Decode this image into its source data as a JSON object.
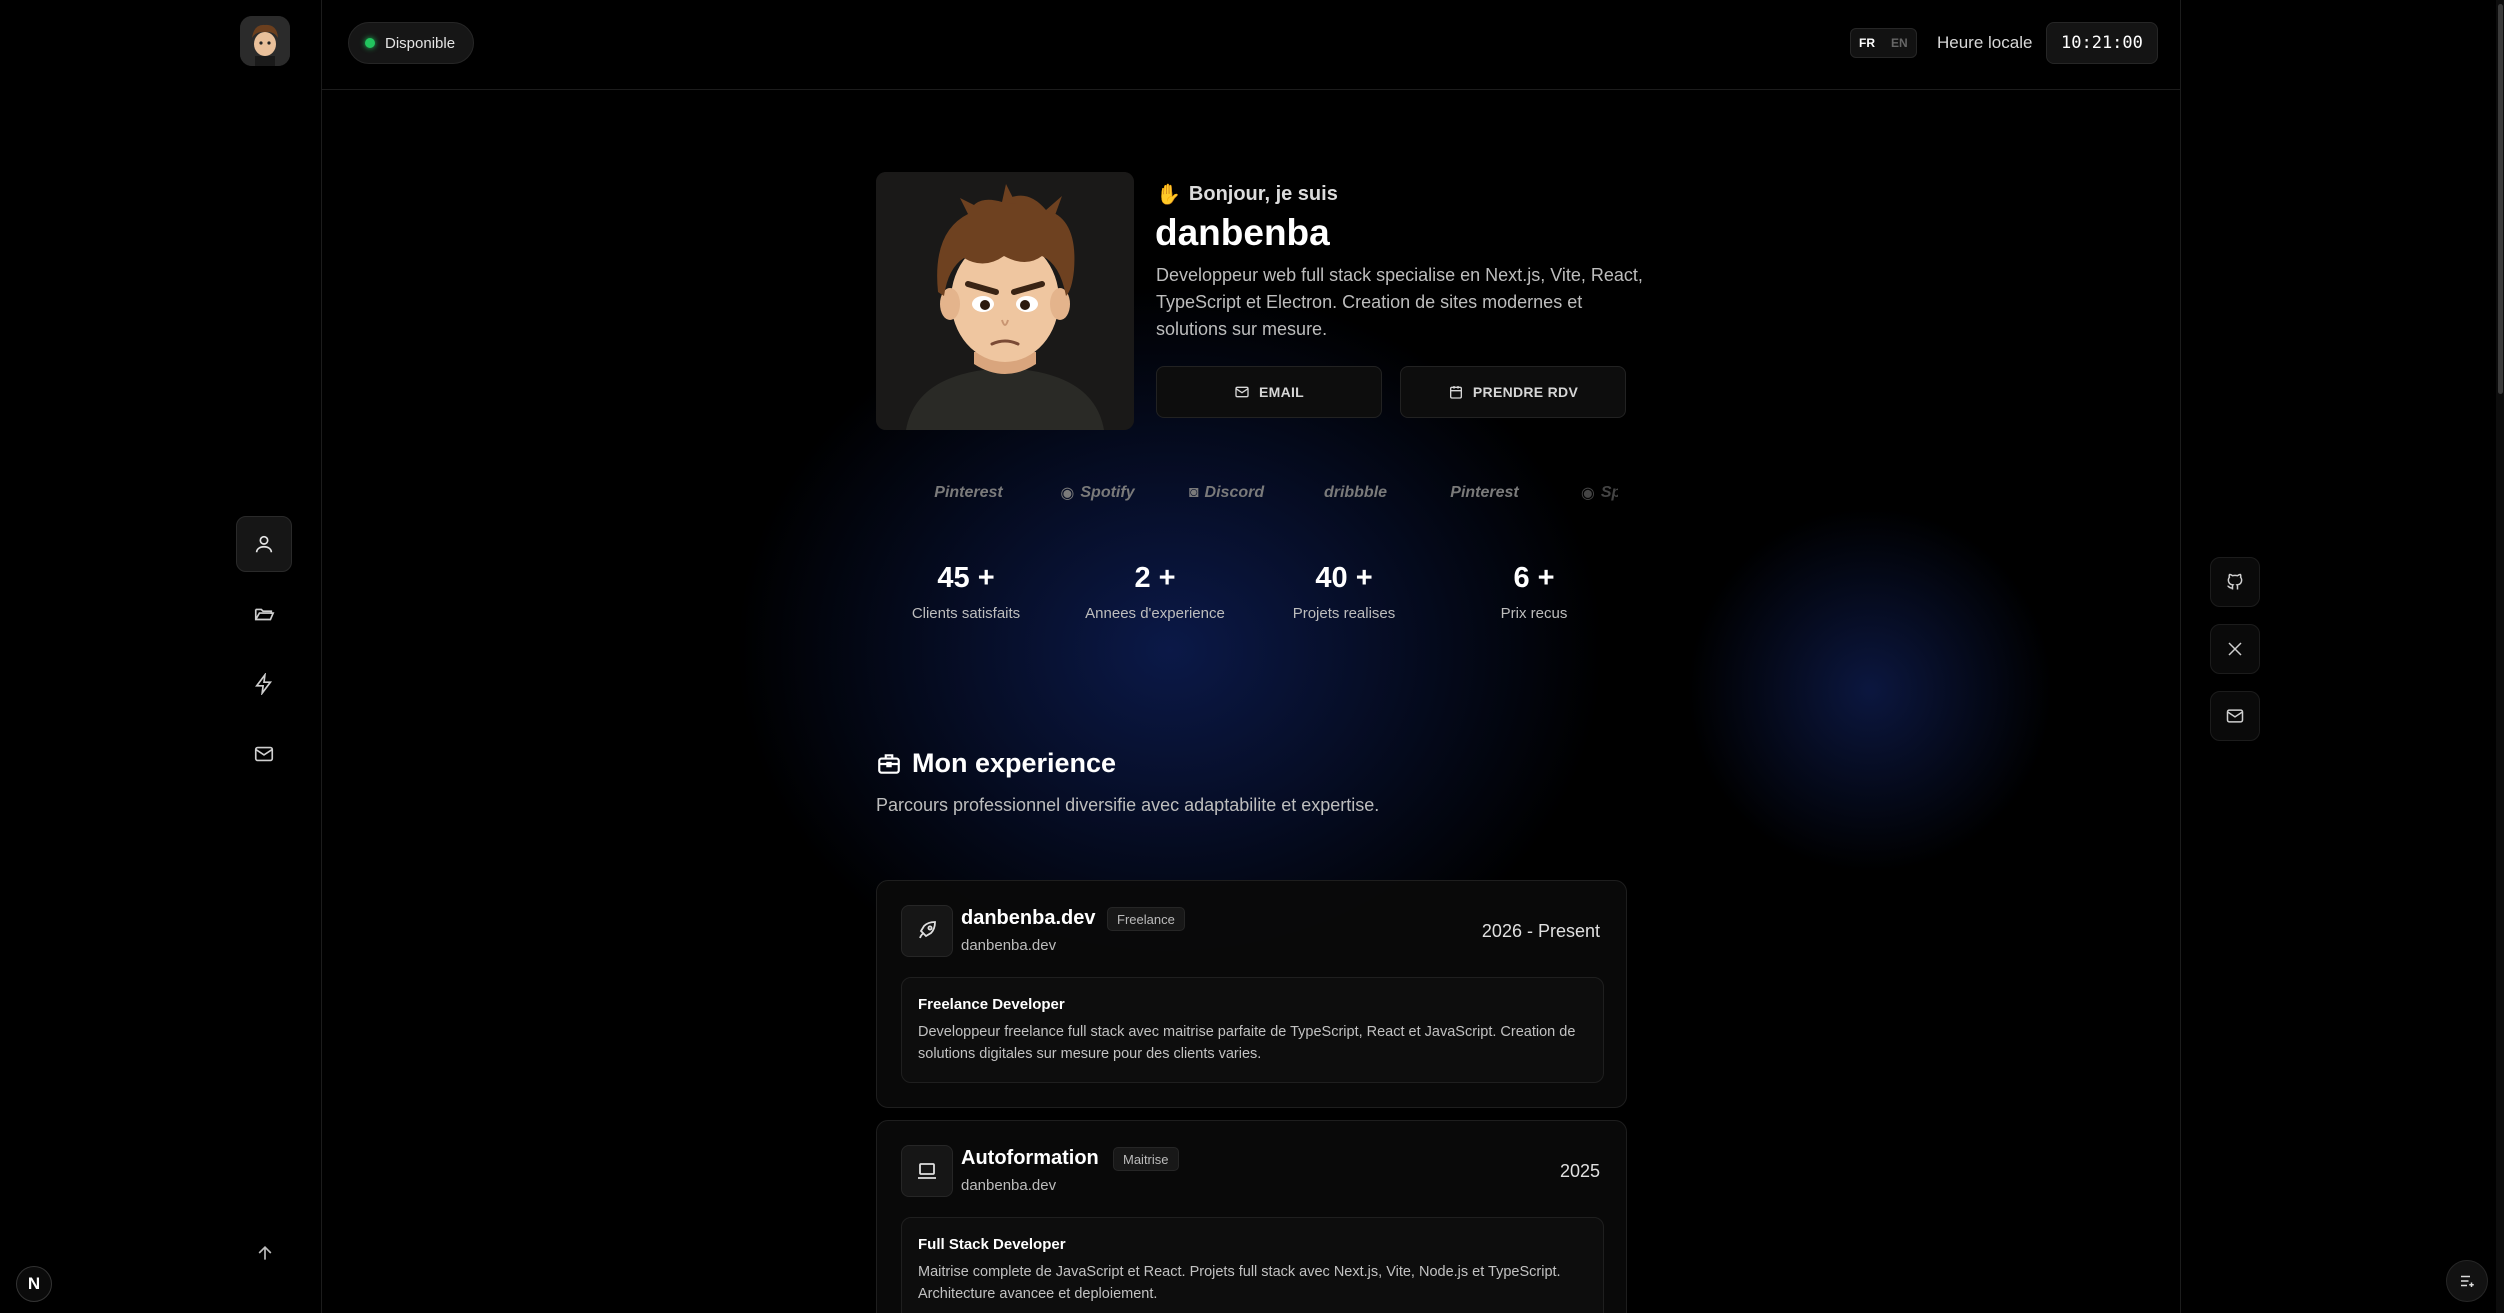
{
  "topbar": {
    "status": "Disponible",
    "lang_fr": "FR",
    "lang_en": "EN",
    "local_time_label": "Heure locale",
    "clock": "10:21:00"
  },
  "sidebar": {
    "items": [
      {
        "name": "profile",
        "icon": "user-icon",
        "active": true
      },
      {
        "name": "projects",
        "icon": "folder-open-icon",
        "active": false
      },
      {
        "name": "skills",
        "icon": "lightning-icon",
        "active": false
      },
      {
        "name": "contact",
        "icon": "mail-icon",
        "active": false
      }
    ],
    "scroll_top_icon": "arrow-up-icon"
  },
  "hero": {
    "greeting": "Bonjour, je suis",
    "name": "danbenba",
    "description": "Developpeur web full stack specialise en Next.js, Vite, React, TypeScript et Electron. Creation de sites modernes et solutions sur mesure.",
    "email_label": "EMAIL",
    "rdv_label": "PRENDRE RDV"
  },
  "brands": [
    "Pinterest",
    "Spotify",
    "Discord",
    "dribbble",
    "Pinterest",
    "Spotif"
  ],
  "stats": [
    {
      "value": "45 +",
      "label": "Clients satisfaits"
    },
    {
      "value": "2 +",
      "label": "Annees d'experience"
    },
    {
      "value": "40 +",
      "label": "Projets realises"
    },
    {
      "value": "6 +",
      "label": "Prix recus"
    }
  ],
  "experience": {
    "title": "Mon experience",
    "subtitle": "Parcours professionnel diversifie avec adaptabilite et expertise.",
    "items": [
      {
        "company": "danbenba.dev",
        "tag": "Freelance",
        "site": "danbenba.dev",
        "date": "2026 - Present",
        "role": "Freelance Developer",
        "text": "Developpeur freelance full stack avec maitrise parfaite de TypeScript, React et JavaScript. Creation de solutions digitales sur mesure pour des clients varies.",
        "icon": "rocket-icon"
      },
      {
        "company": "Autoformation",
        "tag": "Maitrise",
        "site": "danbenba.dev",
        "date": "2025",
        "role": "Full Stack Developer",
        "text": "Maitrise complete de JavaScript et React. Projets full stack avec Next.js, Vite, Node.js et TypeScript. Architecture avancee et deploiement.",
        "icon": "laptop-icon"
      }
    ]
  },
  "socials": [
    {
      "name": "github",
      "icon": "github-icon"
    },
    {
      "name": "x",
      "icon": "x-icon"
    },
    {
      "name": "mail",
      "icon": "mail-icon"
    }
  ],
  "next_badge": "N",
  "colors": {
    "status_dot": "#22c55e",
    "glow": "#1a2f8a",
    "background": "#000000"
  }
}
